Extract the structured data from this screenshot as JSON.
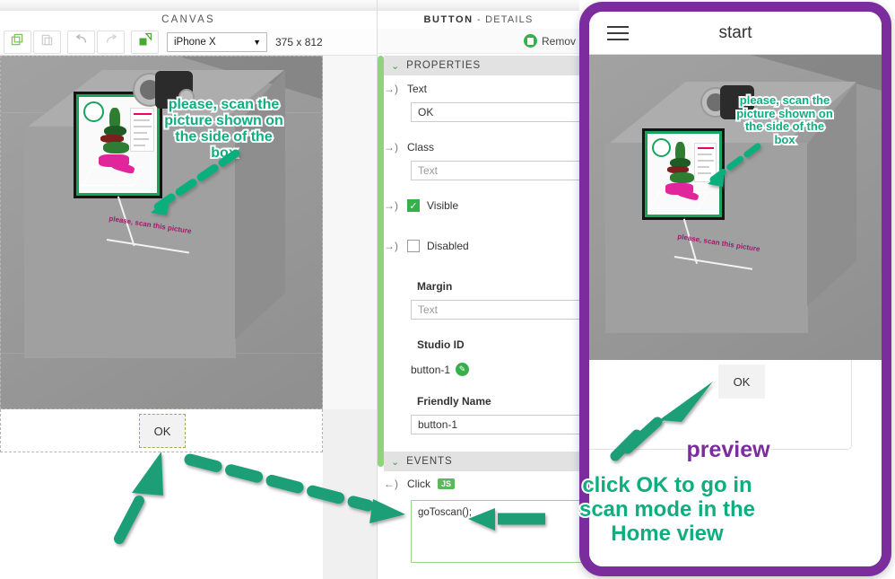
{
  "canvas": {
    "title": "CANVAS",
    "toolbar": {
      "copy_icon": "copy-icon",
      "paste_icon": "paste-icon",
      "undo_icon": "undo-icon",
      "redo_icon": "redo-icon",
      "layers_icon": "layers-icon",
      "device": "iPhone X",
      "device_caret": "▼",
      "dimensions": "375 x 812"
    },
    "ok_button": "OK",
    "scene": {
      "leader_label": "please, scan this picture"
    },
    "annotation": "please, scan the\npicture shown on\nthe side of the\nbox"
  },
  "details": {
    "title_bold": "BUTTON",
    "title_rest": " - DETAILS",
    "remove_label": "Remov",
    "sections": {
      "properties": "PROPERTIES",
      "events": "EVENTS"
    },
    "chevron": "⌄",
    "bind_out": "→)",
    "bind_in": "←)",
    "fields": [
      {
        "label": "Text",
        "value": "OK",
        "placeholder": "",
        "bound": true
      },
      {
        "label": "Class",
        "value": "",
        "placeholder": "Text",
        "bound": true
      },
      {
        "label": "Visible",
        "checked": true,
        "bound": true
      },
      {
        "label": "Disabled",
        "checked": false,
        "bound": true
      },
      {
        "label": "Margin",
        "value": "",
        "placeholder": "Text",
        "bound": false
      },
      {
        "label": "Studio ID",
        "value": "button-1",
        "bound": false
      },
      {
        "label": "Friendly Name",
        "value": "button-1",
        "bound": false
      }
    ],
    "event": {
      "label": "Click",
      "badge": "JS",
      "code": "goToscan();"
    }
  },
  "phone": {
    "menu_icon": "hamburger-menu-icon",
    "title": "start",
    "ok_button": "OK",
    "annotation": "please, scan the\npicture shown on\nthe side of the\nbox",
    "leader_label": "please, scan this picture"
  },
  "annotations": {
    "preview": "preview",
    "instruction": "click OK to go in\nscan mode in the\nHome view"
  },
  "colors": {
    "teal": "#0fae7e",
    "purple": "#7b2d9e",
    "green": "#35b04a",
    "scrollbar": "#8fd37a"
  }
}
